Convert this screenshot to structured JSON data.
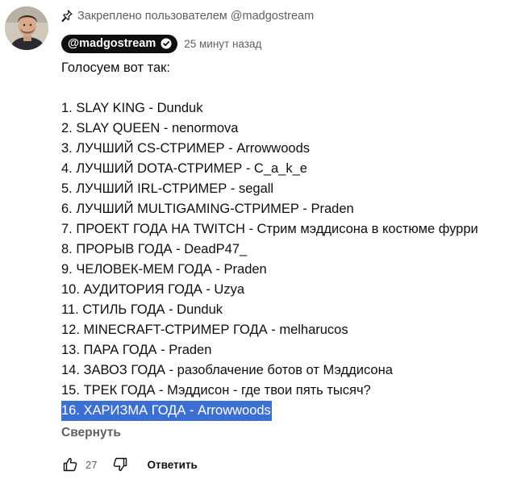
{
  "pinned": {
    "text": "Закреплено пользователем @madgostream",
    "icon": "pin-icon"
  },
  "author": {
    "handle": "@madgostream",
    "verified_icon": "verified-check-icon",
    "timestamp": "25 минут назад"
  },
  "comment": {
    "intro": "Голосуем вот так:",
    "lines": [
      "1. SLAY KING - Dunduk",
      "2. SLAY QUEEN - nenormova",
      "3. ЛУЧШИЙ CS-СТРИМЕР - Arrowwoods",
      "4. ЛУЧШИЙ DOTA-СТРИМЕР - C_a_k_e",
      "5. ЛУЧШИЙ IRL-СТРИМЕР - segall",
      "6. ЛУЧШИЙ MULTIGAMING-СТРИМЕР - Praden",
      "7. ПРОЕКТ ГОДА НА TWITCH - Стрим мэддисона в костюме фурри",
      "8. ПРОРЫВ ГОДА - DeadP47_",
      "9. ЧЕЛОВЕК-МЕМ ГОДА - Praden",
      "10. АУДИТОРИЯ ГОДА - Uzya",
      "11. СТИЛЬ ГОДА - Dunduk",
      "12. MINECRAFT-СТРИМЕР ГОДА - melharucos",
      "13. ПАРА ГОДА - Praden",
      "14. ЗАВОЗ ГОДА - разоблачение ботов от Мэддисона",
      "15. ТРЕК ГОДА - Мэддисон - где твои пять тысяч?",
      "16. ХАРИЗМА ГОДА - Arrowwoods"
    ],
    "highlight_color": "#3b6fd1"
  },
  "collapse_label": "Свернуть",
  "actions": {
    "like_icon": "thumbs-up-icon",
    "like_count": "27",
    "dislike_icon": "thumbs-down-icon",
    "reply_label": "Ответить"
  },
  "colors": {
    "text": "#0f0f0f",
    "secondary": "#606060",
    "chip_bg": "#0f0f0f"
  }
}
